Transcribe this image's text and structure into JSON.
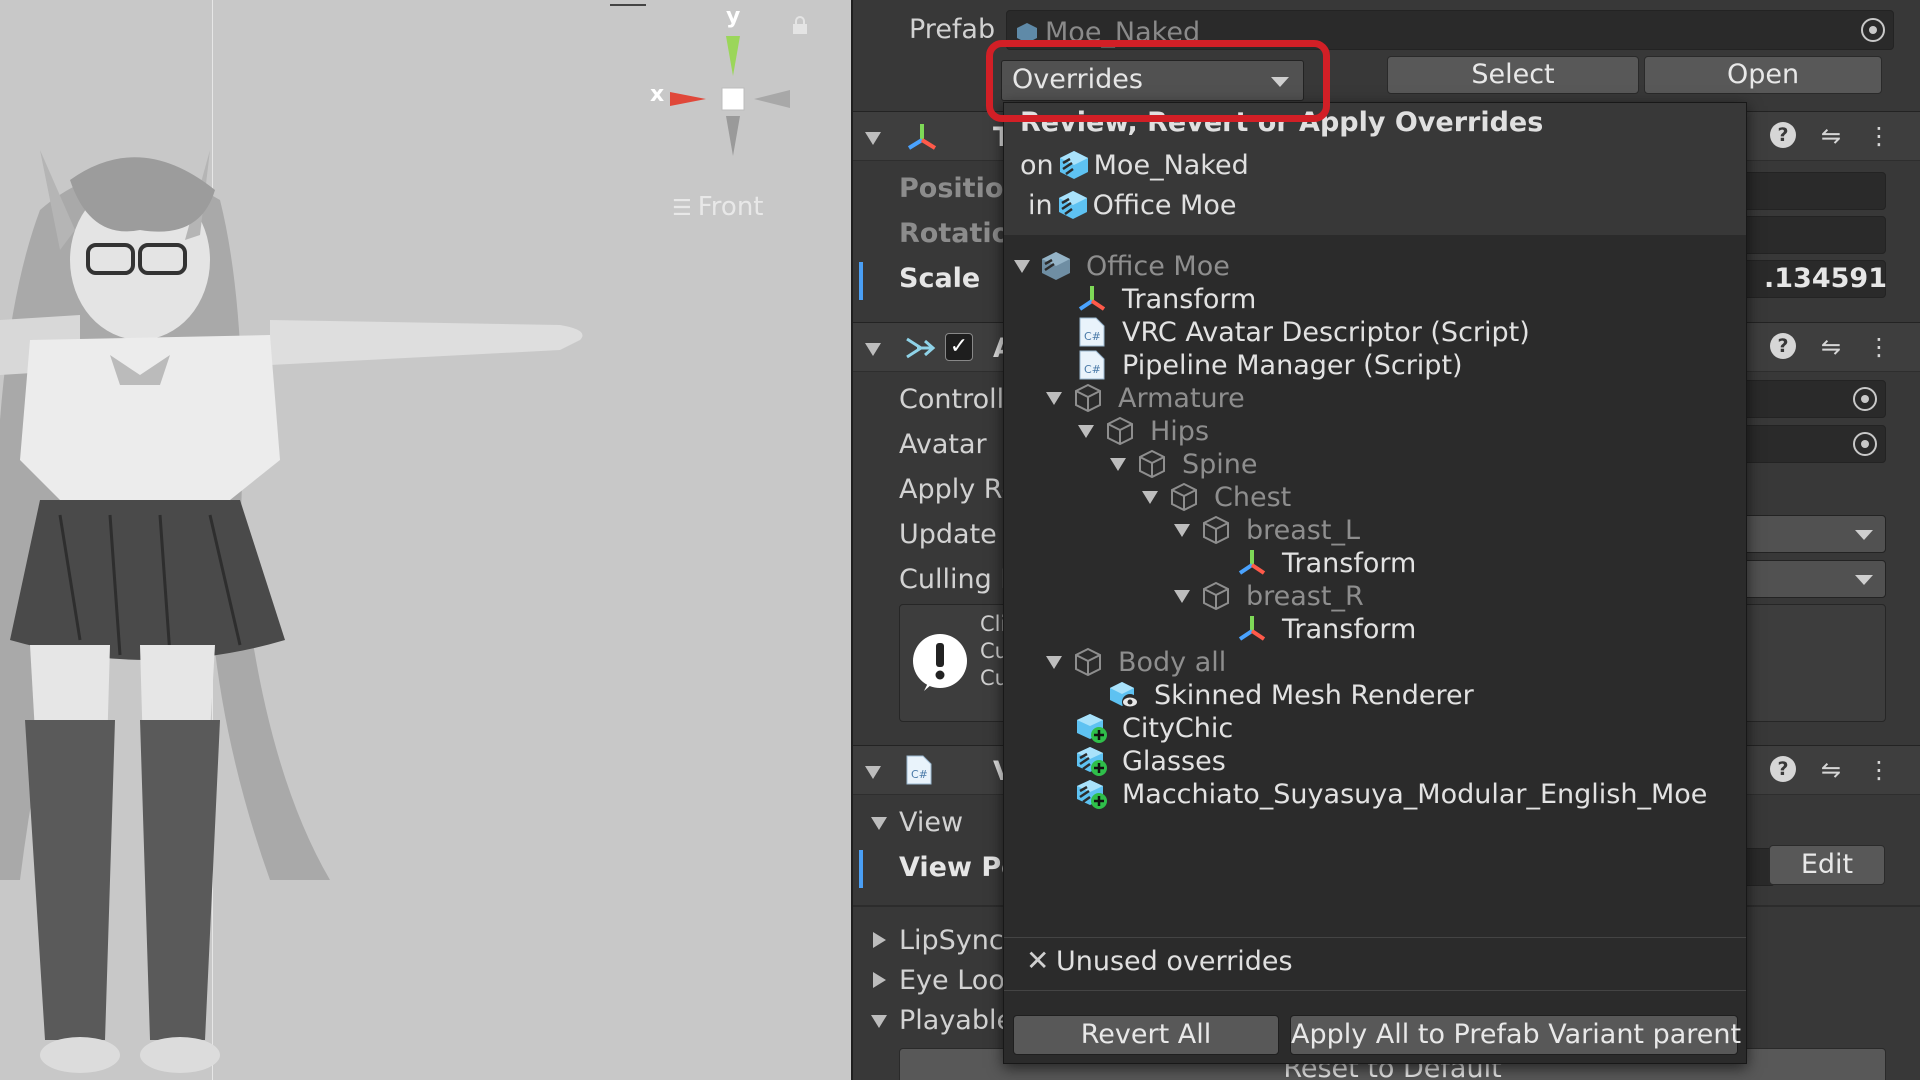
{
  "scene": {
    "gizmo": {
      "y_label": "y",
      "x_label": "x"
    },
    "view_label": "Front"
  },
  "inspector": {
    "prefab_label": "Prefab",
    "prefab_asset": "Moe_Naked",
    "overrides_dropdown": "Overrides",
    "select_button": "Select",
    "open_button": "Open",
    "transform": {
      "header_initial": "T",
      "position_label": "Position",
      "rotation_label": "Rotation",
      "scale_label": "Scale",
      "scale_value_visible": ".134591"
    },
    "animator": {
      "header_initial": "A",
      "controller_label": "Controlle",
      "avatar_label": "Avatar",
      "apply_root_label": "Apply Ro",
      "update_mode_label": "Update M",
      "culling_mode_label": "Culling M",
      "warning_lines": [
        "Cli",
        "Cu",
        "Cu"
      ]
    },
    "descriptor": {
      "header_initial": "V",
      "view_label": "View",
      "view_position_label": "View Po",
      "edit_button": "Edit",
      "lipsync_label": "LipSync",
      "eye_look_label": "Eye Lool",
      "playable_label": "Playable",
      "reset_button": "Reset to Default"
    }
  },
  "popup": {
    "title": "Review, Revert or Apply Overrides",
    "on_prefix": "on",
    "on_target": "Moe_Naked",
    "in_prefix": "in",
    "in_target": "Office Moe",
    "tree": [
      {
        "label": "Office Moe",
        "icon": "prefab-icon",
        "expanded": true,
        "dim": true
      },
      {
        "label": "Transform",
        "icon": "transform-icon",
        "dim": false
      },
      {
        "label": "VRC Avatar Descriptor (Script)",
        "icon": "script-icon",
        "dim": false
      },
      {
        "label": "Pipeline Manager (Script)",
        "icon": "script-icon",
        "dim": false
      },
      {
        "label": "Armature",
        "icon": "gameobject-icon",
        "expanded": true,
        "dim": true
      },
      {
        "label": "Hips",
        "icon": "gameobject-icon",
        "expanded": true,
        "dim": true
      },
      {
        "label": "Spine",
        "icon": "gameobject-icon",
        "expanded": true,
        "dim": true
      },
      {
        "label": "Chest",
        "icon": "gameobject-icon",
        "expanded": true,
        "dim": true
      },
      {
        "label": "breast_L",
        "icon": "gameobject-icon",
        "expanded": true,
        "dim": true
      },
      {
        "label": "Transform",
        "icon": "transform-icon",
        "dim": false
      },
      {
        "label": "breast_R",
        "icon": "gameobject-icon",
        "expanded": true,
        "dim": true
      },
      {
        "label": "Transform",
        "icon": "transform-icon",
        "dim": false
      },
      {
        "label": "Body all",
        "icon": "gameobject-icon",
        "expanded": true,
        "dim": true
      },
      {
        "label": "Skinned Mesh Renderer",
        "icon": "skinned-mesh-icon",
        "dim": false
      },
      {
        "label": "CityChic",
        "icon": "added-prefab-icon",
        "dim": false
      },
      {
        "label": "Glasses",
        "icon": "added-prefab-variant-icon",
        "dim": false
      },
      {
        "label": "Macchiato_Suyasuya_Modular_English_Moe",
        "icon": "added-prefab-variant-icon",
        "dim": false
      }
    ],
    "unused_overrides": "Unused overrides",
    "revert_all": "Revert All",
    "apply_all": "Apply All to Prefab Variant parent"
  },
  "colors": {
    "highlight": "#d21f26",
    "selection_accent": "#4a9ff5",
    "prefab_blue": "#5ec2f2",
    "added_green": "#2fbf4a"
  }
}
